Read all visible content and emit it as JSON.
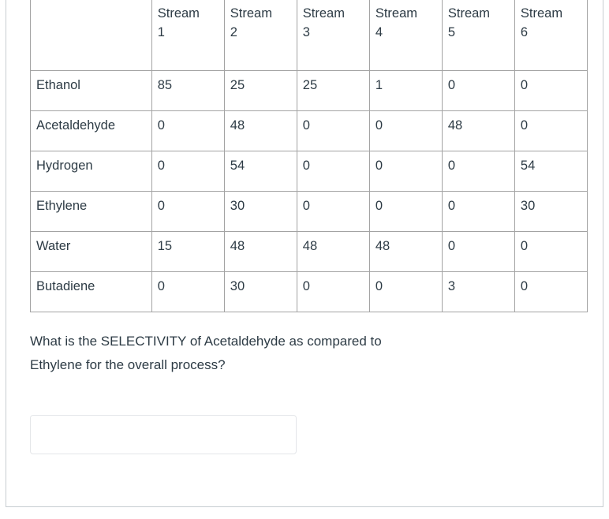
{
  "table": {
    "corner_header": "",
    "column_headers": [
      "Stream 1",
      "Stream 2",
      "Stream 3",
      "Stream 4",
      "Stream 5",
      "Stream 6"
    ],
    "rows": [
      {
        "label": "Ethanol",
        "values": [
          "85",
          "25",
          "25",
          "1",
          "0",
          "0"
        ]
      },
      {
        "label": "Acetaldehyde",
        "values": [
          "0",
          "48",
          "0",
          "0",
          "48",
          "0"
        ]
      },
      {
        "label": "Hydrogen",
        "values": [
          "0",
          "54",
          "0",
          "0",
          "0",
          "54"
        ]
      },
      {
        "label": "Ethylene",
        "values": [
          "0",
          "30",
          "0",
          "0",
          "0",
          "30"
        ]
      },
      {
        "label": "Water",
        "values": [
          "15",
          "48",
          "48",
          "48",
          "0",
          "0"
        ]
      },
      {
        "label": "Butadiene",
        "values": [
          "0",
          "30",
          "0",
          "0",
          "3",
          "0"
        ]
      }
    ]
  },
  "question": {
    "line1": "What is the SELECTIVITY of Acetaldehyde as compared to",
    "line2": "Ethylene for the overall process?",
    "full_text": "What is the SELECTIVITY of Acetaldehyde as compared to Ethylene for the overall process?"
  },
  "answer": {
    "value": "",
    "placeholder": ""
  },
  "colors": {
    "text": "#2d3b45",
    "table_border": "#a3a3a3",
    "table_outer_border": "#8a8a8a",
    "input_border": "#e4e6e9",
    "container_border": "#c7cdd1",
    "background": "#ffffff"
  }
}
